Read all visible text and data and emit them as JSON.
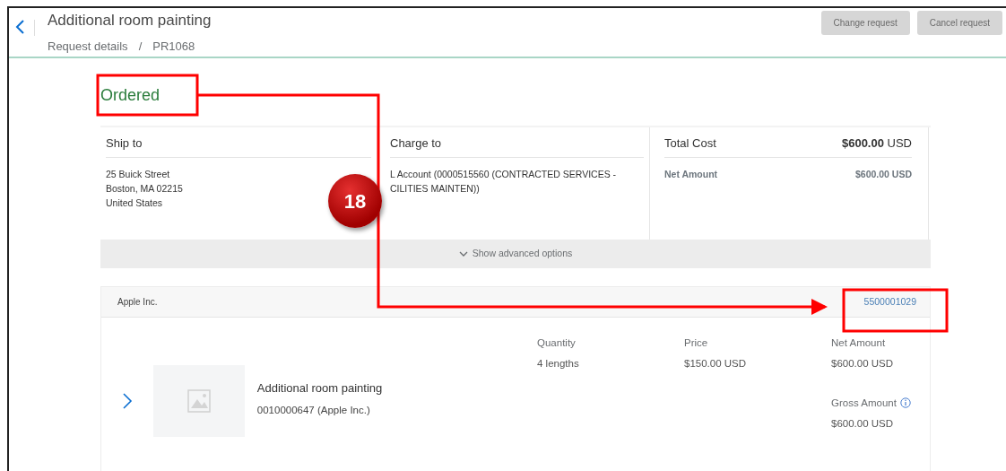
{
  "header": {
    "title": "Additional room painting",
    "breadcrumb": [
      "Request details",
      "PR1068"
    ],
    "breadcrumb_separator": "/",
    "buttons": [
      {
        "label": "Change request",
        "disabled": true
      },
      {
        "label": "Cancel request",
        "disabled": true
      }
    ]
  },
  "status": "Ordered",
  "ship_to": {
    "title": "Ship to",
    "lines": [
      "25 Buick Street",
      "Boston, MA  02215",
      "United States"
    ]
  },
  "charge_to": {
    "title": "Charge to",
    "lines": [
      "L Account (0000515560 (CONTRACTED SERVICES -",
      "CILITIES MAINTEN))"
    ]
  },
  "total": {
    "title": "Total Cost",
    "amount": "**$600.00** USD",
    "rows": [
      {
        "label": "Net Amount",
        "value": "$600.00 USD"
      }
    ]
  },
  "advanced_toggle": "Show advanced options",
  "supplier": {
    "name": "Apple Inc.",
    "order_number": "5500001029"
  },
  "item": {
    "name": "Additional room painting",
    "id": "0010000647 (Apple Inc.)",
    "expanded": false,
    "columns": [
      [
        {
          "label": "Quantity",
          "value": "4 lengths"
        }
      ],
      [
        {
          "label": "Price",
          "value": "$150.00 USD"
        }
      ],
      [
        {
          "label": "Net Amount",
          "value": "$600.00 USD"
        },
        {
          "label": "Gross Amount",
          "value": "$600.00 USD",
          "info": true
        }
      ]
    ]
  },
  "annotation": {
    "step": "18"
  }
}
